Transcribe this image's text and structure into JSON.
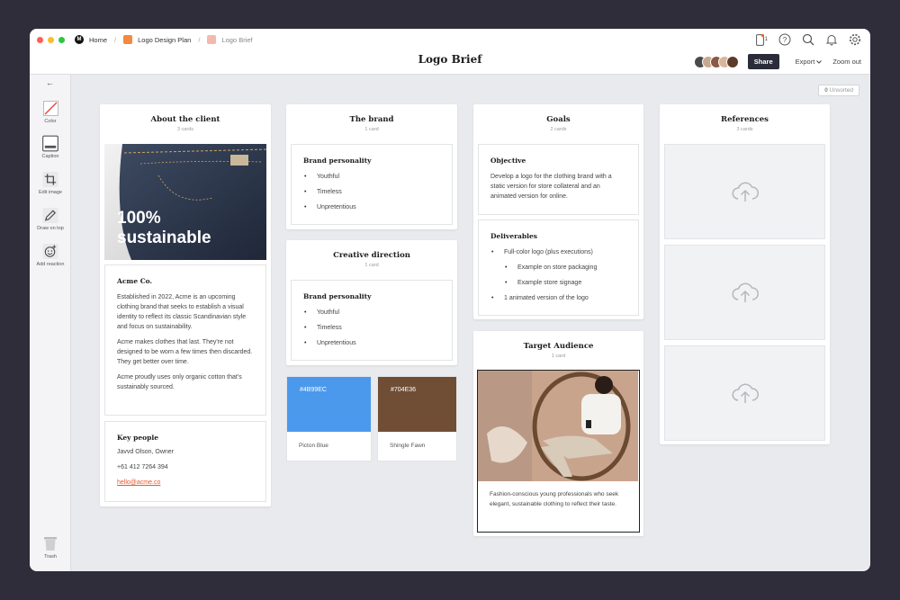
{
  "breadcrumbs": [
    {
      "label": "Home"
    },
    {
      "label": "Logo Design Plan"
    },
    {
      "label": "Logo Brief"
    }
  ],
  "page_title": "Logo Brief",
  "notification_count": "1",
  "toolbar": {
    "share_label": "Share",
    "export_label": "Export",
    "zoom_label": "Zoom out"
  },
  "unsorted": {
    "count": "0",
    "label": "Unsorted"
  },
  "sidebar": {
    "tools": [
      {
        "label": "Color"
      },
      {
        "label": "Caption"
      },
      {
        "label": "Edit image"
      },
      {
        "label": "Draw on top"
      },
      {
        "label": "Add reaction"
      }
    ],
    "trash_label": "Trash"
  },
  "columns": {
    "client": {
      "title": "About the client",
      "count": "3 cards",
      "image_text": [
        "100%",
        "sustainable"
      ],
      "company": {
        "title": "Acme Co.",
        "paragraphs": [
          "Established in 2022, Acme is an upcoming clothing brand that seeks to establish a visual identity to reflect its classic Scandinavian style and focus on sustainability.",
          "Acme makes clothes that last. They're not designed to be worn a few times then discarded. They get better over time.",
          "Acme proudly uses only organic cotton that's sustainably sourced."
        ]
      },
      "people": {
        "title": "Key people",
        "name": "Javvd Olson, Owner",
        "phone": "+61 412 7264 394",
        "email": "hello@acme.co"
      }
    },
    "brand": {
      "title": "The brand",
      "count": "1 card",
      "personality": {
        "title": "Brand personality",
        "items": [
          "Youthful",
          "Timeless",
          "Unpretentious"
        ]
      }
    },
    "creative": {
      "title": "Creative direction",
      "count": "1 card",
      "personality": {
        "title": "Brand personality",
        "items": [
          "Youthful",
          "Timeless",
          "Unpretentious"
        ]
      }
    },
    "swatches": [
      {
        "hex": "#4B99EC",
        "name": "Picton Blue",
        "color": "#4b99ec"
      },
      {
        "hex": "#704E36",
        "name": "Shingle Fawn",
        "color": "#704e36"
      }
    ],
    "goals": {
      "title": "Goals",
      "count": "2 cards",
      "objective": {
        "title": "Objective",
        "text": "Develop a logo for the clothing brand with a static version for store collateral and an animated version for online."
      },
      "deliverables": {
        "title": "Deliverables",
        "items": [
          {
            "text": "Full-color logo (plus executions)",
            "level": 0
          },
          {
            "text": "Example on store packaging",
            "level": 1
          },
          {
            "text": "Example store signage",
            "level": 1
          },
          {
            "text": "1 animated version of the logo",
            "level": 0
          }
        ]
      }
    },
    "audience": {
      "title": "Target Audience",
      "count": "1 card",
      "caption": "Fashion-conscious young professionals who seek elegant, sustainable clothing to reflect their taste."
    },
    "references": {
      "title": "References",
      "count": "3 cards"
    }
  },
  "colors": {
    "accent_orange": "#f5893d",
    "accent_pink": "#f3b9ad",
    "share_bg": "#2b2c39",
    "link": "#e8562a"
  }
}
